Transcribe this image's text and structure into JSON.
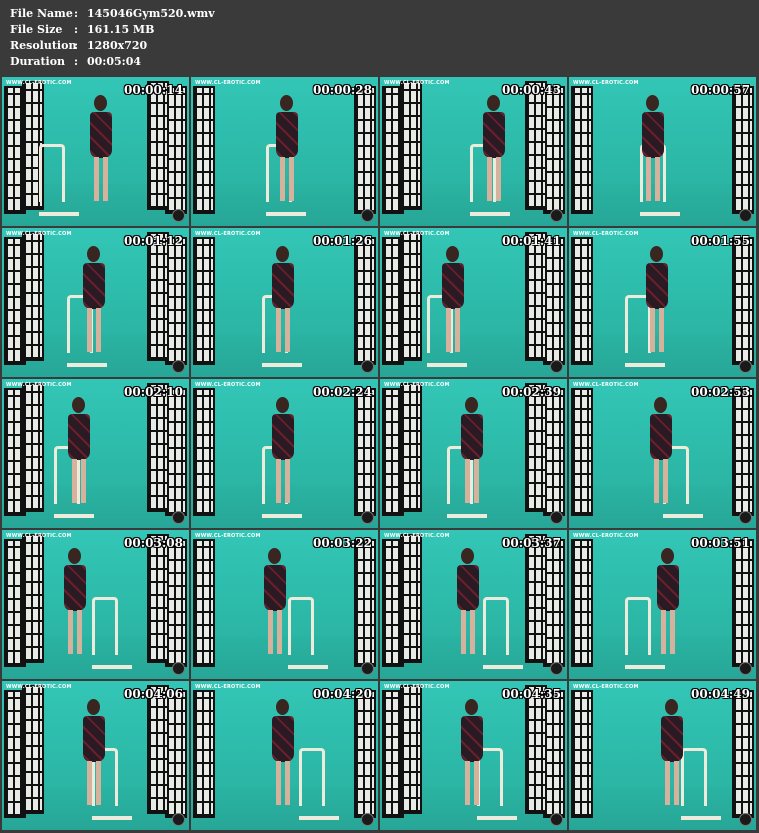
{
  "meta": {
    "file_name_label": "File Name",
    "file_name": "145046Gym520.wmv",
    "file_size_label": "File Size",
    "file_size": "161.15 MB",
    "resolution_label": "Resolution",
    "resolution": "1280x720",
    "duration_label": "Duration",
    "duration": "00:05:04",
    "separator": ":"
  },
  "watermark": "WWW.CL-EROTIC.COM",
  "thumbnails": [
    {
      "time": "00:00:14"
    },
    {
      "time": "00:00:28"
    },
    {
      "time": "00:00:43"
    },
    {
      "time": "00:00:57"
    },
    {
      "time": "00:01:12"
    },
    {
      "time": "00:01:26"
    },
    {
      "time": "00:01:41"
    },
    {
      "time": "00:01:55"
    },
    {
      "time": "00:02:10"
    },
    {
      "time": "00:02:24"
    },
    {
      "time": "00:02:39"
    },
    {
      "time": "00:02:53"
    },
    {
      "time": "00:03:08"
    },
    {
      "time": "00:03:22"
    },
    {
      "time": "00:03:37"
    },
    {
      "time": "00:03:51"
    },
    {
      "time": "00:04:06"
    },
    {
      "time": "00:04:20"
    },
    {
      "time": "00:04:35"
    },
    {
      "time": "00:04:49"
    }
  ],
  "colors": {
    "background": "#3a3a3a",
    "backdrop": "#2fbfae",
    "text": "#ffffff"
  }
}
